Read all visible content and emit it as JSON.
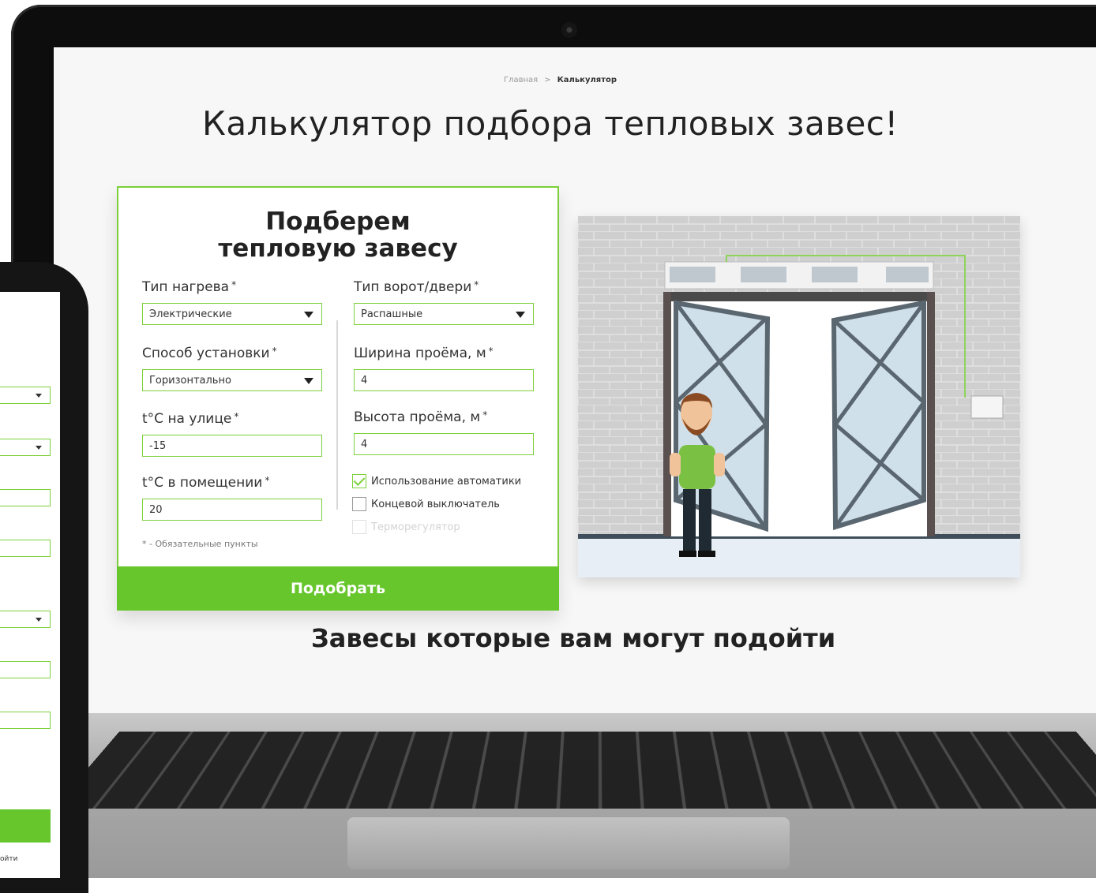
{
  "breadcrumb": {
    "home": "Главная",
    "separator": ">",
    "current": "Калькулятор"
  },
  "page": {
    "title": "Калькулятор подбора тепловых завес!"
  },
  "form": {
    "title_line1": "Подберем",
    "title_line2": "тепловую завесу",
    "required_mark": "*",
    "heating_type": {
      "label": "Тип нагрева",
      "value": "Электрические"
    },
    "gate_type": {
      "label": "Тип ворот/двери",
      "value": "Распашные"
    },
    "install_method": {
      "label": "Способ установки",
      "value": "Горизонтально"
    },
    "opening_width": {
      "label": "Ширина проёма, м",
      "value": "4"
    },
    "outdoor_temp": {
      "label": "t°C на улице",
      "value": "-15"
    },
    "opening_height": {
      "label": "Высота проёма, м",
      "value": "4"
    },
    "indoor_temp": {
      "label": "t°C в помещении",
      "value": "20"
    },
    "checkboxes": [
      {
        "label": "Использование автоматики",
        "checked": true,
        "disabled": false
      },
      {
        "label": "Концевой выключатель",
        "checked": false,
        "disabled": false
      },
      {
        "label": "Терморегулятор",
        "checked": false,
        "disabled": true
      }
    ],
    "required_note": "* - Обязательные пункты",
    "submit_label": "Подобрать"
  },
  "results": {
    "title": "Завесы которые вам могут подойти"
  },
  "phone": {
    "partial_text": "ойти"
  },
  "colors": {
    "accent": "#66c62c",
    "accent_border": "#7cd03a",
    "shirt": "#7ac143"
  }
}
